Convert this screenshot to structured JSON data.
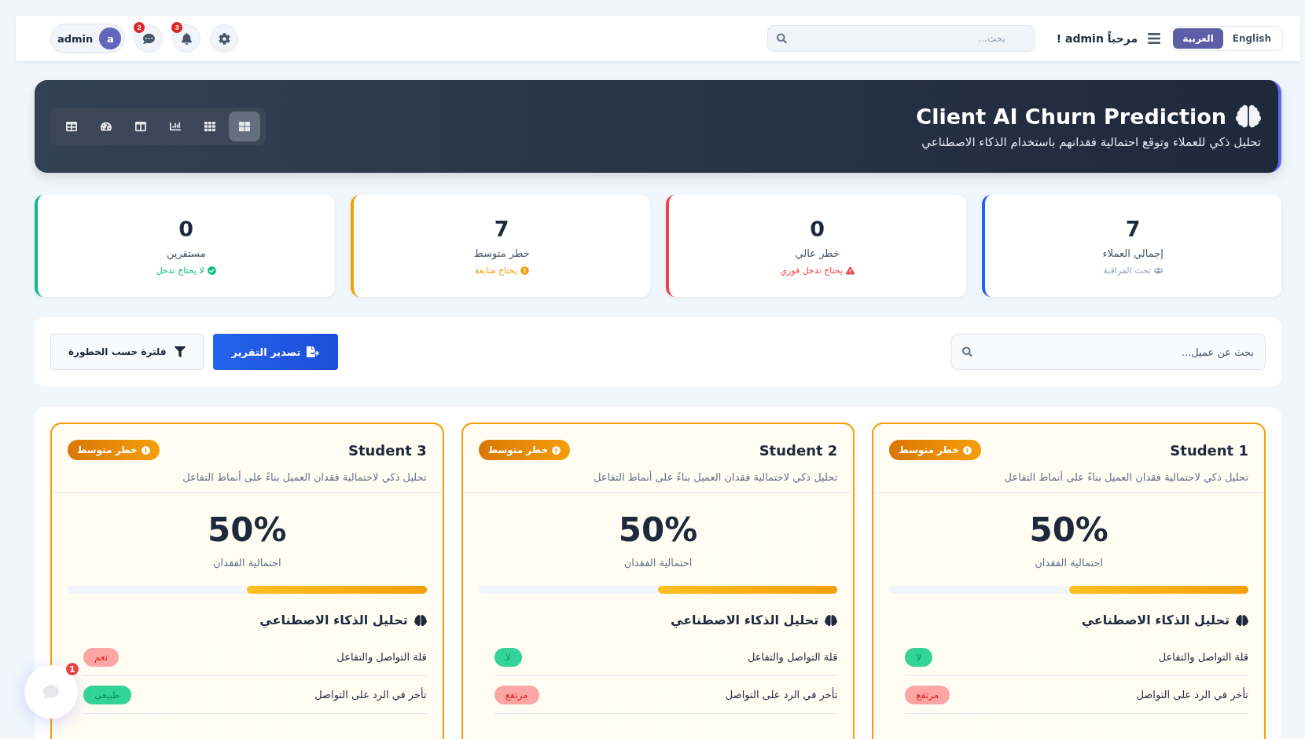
{
  "header": {
    "languages": [
      {
        "label": "English",
        "selected": false
      },
      {
        "label": "العربية",
        "selected": true
      }
    ],
    "welcome": "مرحباً admin !",
    "search": {
      "placeholder": "بحث..."
    },
    "user": {
      "name": "admin",
      "initial": "a"
    },
    "messages_badge": "2",
    "notifications_badge": "3"
  },
  "hero": {
    "title": "Client AI Churn Prediction",
    "subtitle": "تحليل ذكي للعملاء وتوقع احتمالية فقدانهم باستخدام الذكاء الاصطناعي",
    "views": [
      {
        "kind": "grid",
        "selected": true
      },
      {
        "kind": "cells",
        "selected": false
      },
      {
        "kind": "chart",
        "selected": false
      },
      {
        "kind": "columns",
        "selected": false
      },
      {
        "kind": "gauge",
        "selected": false
      },
      {
        "kind": "table",
        "selected": false
      }
    ]
  },
  "stats": [
    {
      "value": "7",
      "label": "إجمالي العملاء",
      "note": "تحت المراقبة",
      "kind": "users",
      "color": "#2563eb"
    },
    {
      "value": "0",
      "label": "خطر عالي",
      "note": "يحتاج تدخل فوري",
      "kind": "warning",
      "color": "#ef4444"
    },
    {
      "value": "7",
      "label": "خطر متوسط",
      "note": "يحتاج متابعة",
      "kind": "info",
      "color": "#f59e0b"
    },
    {
      "value": "0",
      "label": "مستقرين",
      "note": "لا يحتاج تدخل",
      "kind": "check",
      "color": "#10b981"
    }
  ],
  "toolbar": {
    "search": {
      "placeholder": "بحث عن عميل..."
    },
    "export_button": "تصدير التقرير",
    "filter_button": "فلترة حسب الخطورة"
  },
  "clients": [
    {
      "name": "Student 1",
      "risk": "خطر متوسط",
      "description": "تحليل ذكي لاحتمالية فقدان العميل بناءً على أنماط التفاعل",
      "probability": "50%",
      "probability_label": "احتمالية الفقدان",
      "level": 0.5,
      "analysis_title": "تحليل الذكاء الاصطناعي",
      "factors": [
        {
          "label": "قلة التواصل والتفاعل",
          "value": "لا",
          "kind": "good"
        },
        {
          "label": "تأخر في الرد على التواصل",
          "value": "مرتفع",
          "kind": "bad"
        }
      ]
    },
    {
      "name": "Student 2",
      "risk": "خطر متوسط",
      "description": "تحليل ذكي لاحتمالية فقدان العميل بناءً على أنماط التفاعل",
      "probability": "50%",
      "probability_label": "احتمالية الفقدان",
      "level": 0.5,
      "analysis_title": "تحليل الذكاء الاصطناعي",
      "factors": [
        {
          "label": "قلة التواصل والتفاعل",
          "value": "لا",
          "kind": "good"
        },
        {
          "label": "تأخر في الرد على التواصل",
          "value": "مرتفع",
          "kind": "bad"
        }
      ]
    },
    {
      "name": "Student 3",
      "risk": "خطر متوسط",
      "description": "تحليل ذكي لاحتمالية فقدان العميل بناءً على أنماط التفاعل",
      "probability": "50%",
      "probability_label": "احتمالية الفقدان",
      "level": 0.5,
      "analysis_title": "تحليل الذكاء الاصطناعي",
      "factors": [
        {
          "label": "قلة التواصل والتفاعل",
          "value": "نعم",
          "kind": "bad"
        },
        {
          "label": "تأخر في الرد على التواصل",
          "value": "طبيعي",
          "kind": "good"
        }
      ]
    }
  ],
  "chat_widget": {
    "badge": "1"
  }
}
